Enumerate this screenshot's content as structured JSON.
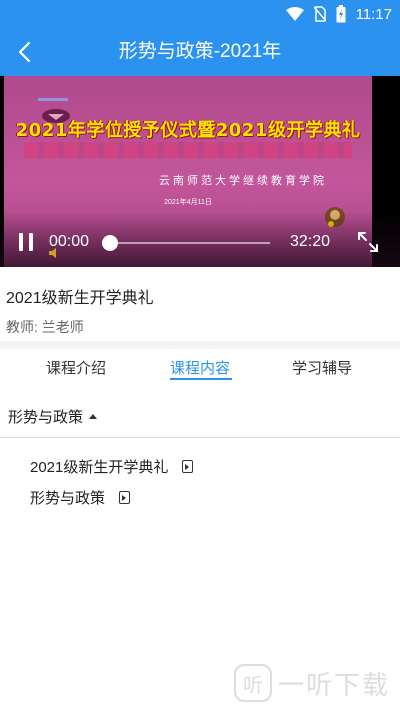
{
  "status_bar": {
    "time": "11:17"
  },
  "app_bar": {
    "title": "形势与政策-2021年"
  },
  "video": {
    "headline": "2021年学位授予仪式暨2021级开学典礼",
    "school": "云南师范大学继续教育学院",
    "date": "2021年4月11日",
    "current_time": "00:00",
    "total_time": "32:20",
    "progress": 0
  },
  "lesson": {
    "title": "2021级新生开学典礼",
    "teacher": "教师: 兰老师"
  },
  "tabs": [
    {
      "label": "课程介绍"
    },
    {
      "label": "课程内容",
      "active": true
    },
    {
      "label": "学习辅导"
    }
  ],
  "section": {
    "title": "形势与政策"
  },
  "chapters": [
    {
      "label": "2021级新生开学典礼",
      "icon": "play-document-icon"
    },
    {
      "label": "形势与政策",
      "icon": "play-document-icon"
    }
  ],
  "watermark": {
    "text": "一听下载",
    "icon": "听"
  },
  "colors": {
    "primary": "#2b93ef",
    "video_bg": "#c3569a",
    "headline": "#ffe600"
  }
}
